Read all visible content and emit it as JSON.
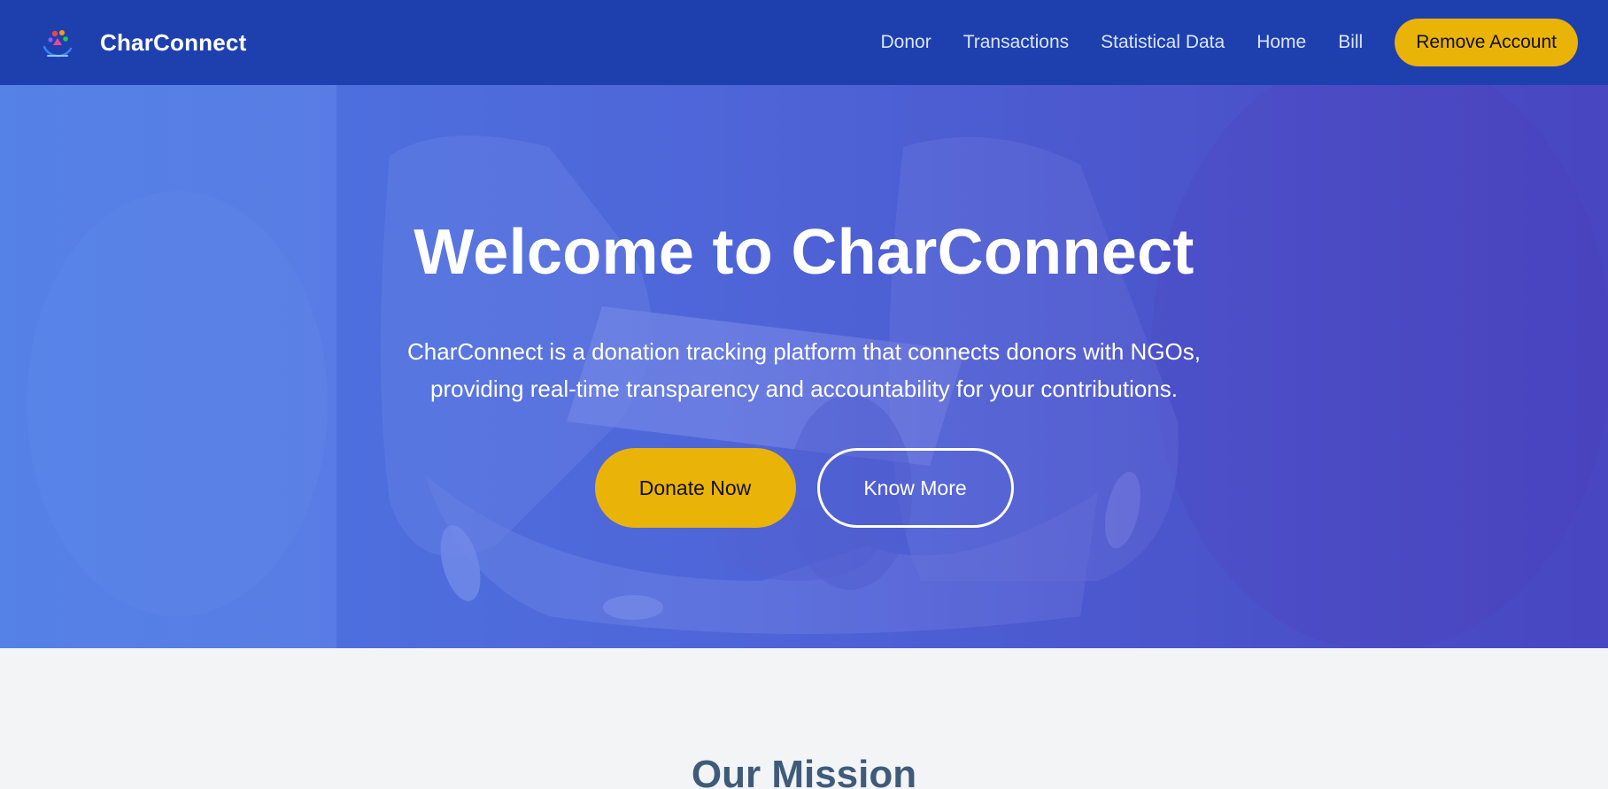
{
  "navbar": {
    "logo_icon": "charconnect-logo-icon",
    "brand": "CharConnect",
    "links": [
      "Donor",
      "Transactions",
      "Statistical Data",
      "Home",
      "Bill"
    ],
    "remove_account_label": "Remove Account"
  },
  "hero": {
    "title": "Welcome to CharConnect",
    "description": "CharConnect is a donation tracking platform that connects donors with NGOs, providing real-time transparency and accountability for your contributions.",
    "donate_label": "Donate Now",
    "know_more_label": "Know More"
  },
  "mission": {
    "title": "Our Mission"
  },
  "colors": {
    "navbar_bg": "#1e40af",
    "accent": "#eab308",
    "hero_overlay": "#5568dc",
    "page_bg": "#f3f4f6",
    "mission_title": "#3f5b7a"
  }
}
